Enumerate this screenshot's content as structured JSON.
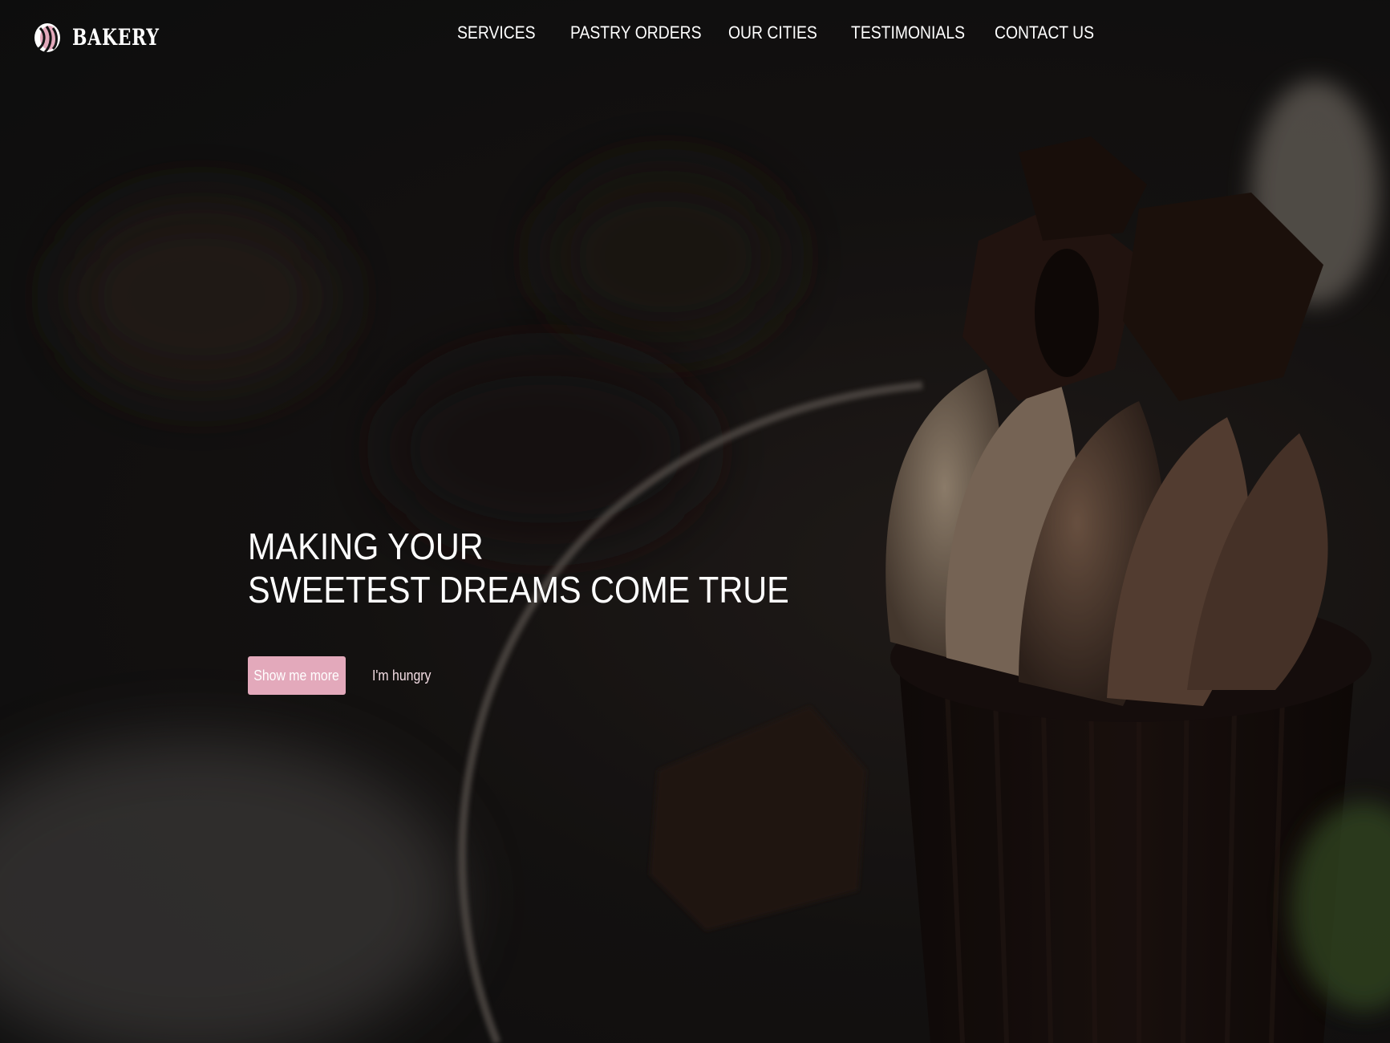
{
  "brand": {
    "name": "BAKERY",
    "logo_icon": "bread-icon"
  },
  "nav": {
    "items": [
      {
        "label": "SERVICES"
      },
      {
        "label": "PASTRY ORDERS"
      },
      {
        "label": "OUR CITIES"
      },
      {
        "label": "TESTIMONIALS"
      },
      {
        "label": "CONTACT US"
      }
    ]
  },
  "hero": {
    "title_line1": "MAKING YOUR",
    "title_line2": "SWEETEST DREAMS COME TRUE",
    "primary_button": "Show me more",
    "secondary_button": "I'm hungry",
    "background_image": "dark chocolate cupcake photo"
  },
  "colors": {
    "accent": "#e3a9bb",
    "background": "#141414",
    "text": "#ffffff"
  }
}
